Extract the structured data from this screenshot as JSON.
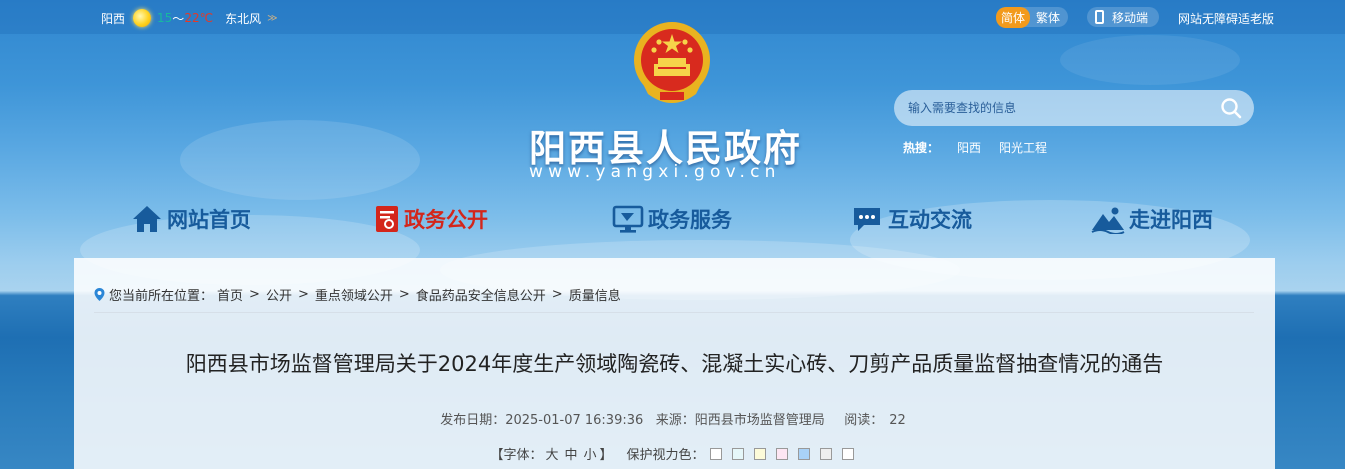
{
  "topbar": {
    "weather": {
      "city": "阳西",
      "low": "15",
      "range_sep": "～",
      "high": "22℃",
      "wind": "东北风",
      "wind_level": "≫",
      "icon": "sun-icon"
    },
    "lang": {
      "simplified": "简体",
      "traditional": "繁体"
    },
    "mobile_label": "移动端",
    "accessibility_label": "网站无障碍适老版"
  },
  "header": {
    "emblem": "national-emblem",
    "title": "阳西县人民政府",
    "url": "www.yangxi.gov.cn"
  },
  "search": {
    "placeholder": "输入需要查找的信息",
    "hot_label": "热搜：",
    "hot_items": [
      "阳西",
      "阳光工程"
    ]
  },
  "nav": {
    "items": [
      {
        "label": "网站首页",
        "icon": "home-icon",
        "active": false
      },
      {
        "label": "政务公开",
        "icon": "document-icon",
        "active": true
      },
      {
        "label": "政务服务",
        "icon": "monitor-icon",
        "active": false
      },
      {
        "label": "互动交流",
        "icon": "chat-icon",
        "active": false
      },
      {
        "label": "走进阳西",
        "icon": "mountain-icon",
        "active": false
      }
    ],
    "active_color": "#d3261b",
    "color": "#175b9c"
  },
  "breadcrumb": {
    "prefix": "您当前所在位置：",
    "items": [
      "首页",
      "公开",
      "重点领域公开",
      "食品药品安全信息公开",
      "质量信息"
    ],
    "separator": ">"
  },
  "article": {
    "title": "阳西县市场监督管理局关于2024年度生产领域陶瓷砖、混凝土实心砖、刀剪产品质量监督抽查情况的通告",
    "publish_label": "发布日期：",
    "publish_date": "2025-01-07 16:39:36",
    "source_label": "来源：",
    "source": "阳西县市场监督管理局",
    "views_label": "阅读：",
    "views": "22"
  },
  "tools": {
    "font_open": "【字体：",
    "sizes": [
      "大",
      "中",
      "小"
    ],
    "font_close": "】",
    "eye_label": "保护视力色：",
    "swatches": [
      "#ffffff",
      "#e6f7f9",
      "#fdfbd9",
      "#fde6f3",
      "#a9d2f7",
      "#eeeeee",
      "#ffffff"
    ]
  }
}
